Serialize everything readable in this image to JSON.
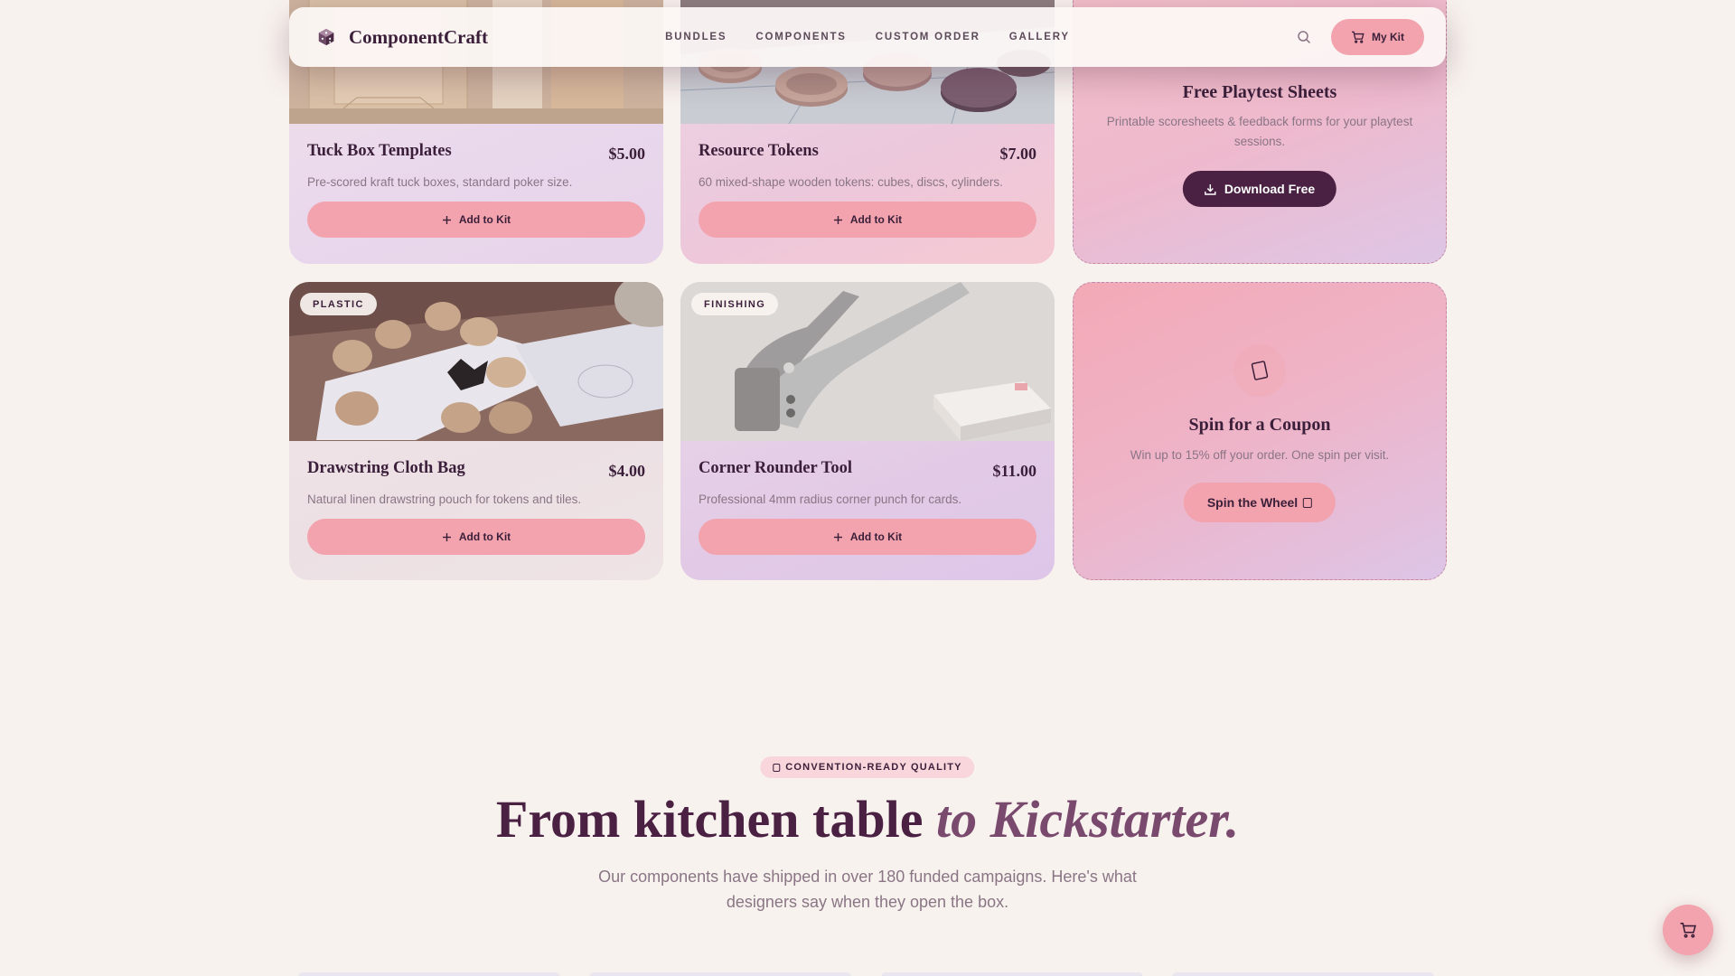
{
  "nav": {
    "brand": "ComponentCraft",
    "links": [
      "BUNDLES",
      "COMPONENTS",
      "CUSTOM ORDER",
      "GALLERY"
    ],
    "kit_label": "My Kit"
  },
  "products": [
    {
      "title": "Tuck Box Templates",
      "price": "$5.00",
      "desc": "Pre-scored kraft tuck boxes, standard poker size.",
      "button": "Add to Kit"
    },
    {
      "title": "Resource Tokens",
      "price": "$7.00",
      "desc": "60 mixed-shape wooden tokens: cubes, discs, cylinders.",
      "button": "Add to Kit"
    },
    {
      "title": "Drawstring Cloth Bag",
      "price": "$4.00",
      "desc": "Natural linen drawstring pouch for tokens and tiles.",
      "button": "Add to Kit",
      "badge": "PLASTIC"
    },
    {
      "title": "Corner Rounder Tool",
      "price": "$11.00",
      "desc": "Professional 4mm radius corner punch for cards.",
      "button": "Add to Kit",
      "badge": "FINISHING"
    }
  ],
  "promo_playtest": {
    "title": "Free Playtest Sheets",
    "text": "Printable scoresheets & feedback forms for your playtest sessions.",
    "button": "Download Free"
  },
  "promo_coupon": {
    "title": "Spin for a Coupon",
    "text": "Win up to 15% off your order. One spin per visit.",
    "button": "Spin the Wheel"
  },
  "section": {
    "pill": "CONVENTION-READY QUALITY",
    "headline_main": "From kitchen table ",
    "headline_accent": "to Kickstarter.",
    "subtext": "Our components have shipped in over 180 funded campaigns. Here's what designers say when they open the box."
  },
  "colors": {
    "accent_pink": "#f2a3ad",
    "deep_plum": "#4a2142",
    "background": "#f8f2ee"
  },
  "icons": [
    "dice-logo-icon",
    "search-icon",
    "cart-icon",
    "plus-icon",
    "download-icon",
    "card-icon"
  ]
}
